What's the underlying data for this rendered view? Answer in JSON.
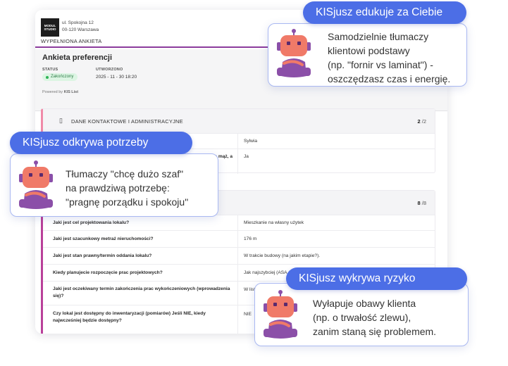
{
  "document": {
    "logo": {
      "line1": "MODUL",
      "line2": "STUDIO"
    },
    "address": {
      "street": "ul. Spokojna 12",
      "city": "00-120 Warszawa"
    },
    "filled_label": "WYPEŁNIONA ANKIETA",
    "title": "Ankieta preferencji",
    "status_label": "STATUS",
    "status_value": "Zakończony",
    "created_label": "UTWORZONO",
    "created_value": "2025 - 11 - 30 18:20",
    "powered_by": "Powered by",
    "powered_brand": "KIS List",
    "section1": {
      "title": "DANE KONTAKTOWE I ADMINISTRACYJNE",
      "count_done": "2",
      "count_total": "/2",
      "rows": [
        {
          "question": "",
          "answer": "Sylwia"
        },
        {
          "question": "lę mąż, a",
          "answer": "Ja"
        }
      ]
    },
    "section2": {
      "count_done": "8",
      "count_total": "/8",
      "rows": [
        {
          "question": "Jaki jest cel projektowania lokalu?",
          "answer": "Mieszkanie na własny użytek"
        },
        {
          "question": "Jaki jest szacunkowy metraż nieruchomości?",
          "answer": "176 m"
        },
        {
          "question": "Jaki jest stan prawny/termin oddania lokalu?",
          "answer": "W trakcie budowy (na jakim etapie?)."
        },
        {
          "question": "Kiedy planujecie rozpoczęcie prac projektowych?",
          "answer": "Jak najszybciej (ASA"
        },
        {
          "question": "Jaki jest oczekiwany termin zakończenia prac wykończeniowych (wprowadzenia się)?",
          "answer": "W listo"
        },
        {
          "question": "Czy lokal jest dostępny do inwentaryzacji (pomiarów) Jeśli NIE, kiedy najwcześniej będzie dostępny?",
          "answer": "NIE"
        }
      ]
    }
  },
  "callouts": {
    "education": {
      "title": "KISjusz edukuje za Ciebie",
      "lines": [
        "Samodzielnie tłumaczy",
        "klientowi podstawy",
        "(np. \"fornir vs laminat\") -",
        "oszczędzasz czas i energię."
      ]
    },
    "needs": {
      "title": "KISjusz odkrywa potrzeby",
      "lines": [
        "Tłumaczy \"chcę dużo szaf\"",
        "na prawdziwą potrzebę:",
        "\"pragnę porządku i spokoju\""
      ]
    },
    "risk": {
      "title": "KISjusz wykrywa ryzyko",
      "lines": [
        "Wyłapuje obawy klienta",
        "(np. o trwałość zlewu),",
        "zanim staną się problemem."
      ]
    }
  },
  "colors": {
    "accent_blue": "#4c6ee6",
    "robot_head": "#f07a68",
    "robot_body": "#8b4fa8",
    "status_green": "#2fb457"
  }
}
